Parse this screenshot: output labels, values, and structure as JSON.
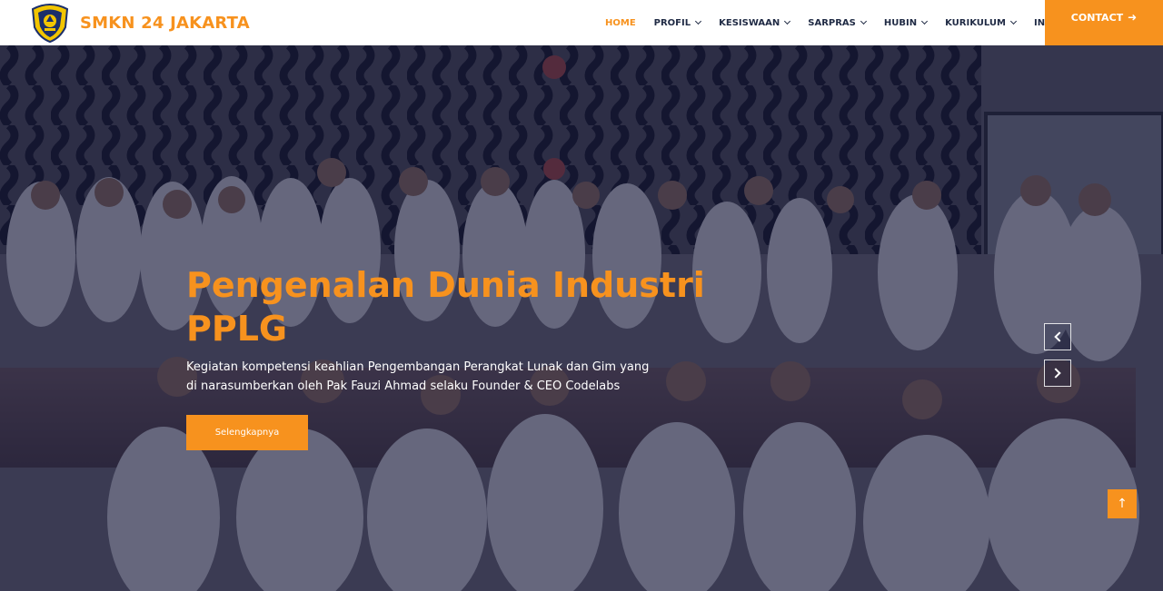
{
  "header": {
    "brand_name": "SMKN 24 JAKARTA",
    "logo_icon": "school-crest-icon",
    "nav": [
      {
        "label": "HOME",
        "active": true,
        "has_dropdown": false
      },
      {
        "label": "PROFIL",
        "active": false,
        "has_dropdown": true
      },
      {
        "label": "KESISWAAN",
        "active": false,
        "has_dropdown": true
      },
      {
        "label": "SARPRAS",
        "active": false,
        "has_dropdown": true
      },
      {
        "label": "HUBIN",
        "active": false,
        "has_dropdown": true
      },
      {
        "label": "KURIKULUM",
        "active": false,
        "has_dropdown": true
      },
      {
        "label": "INFO",
        "active": false,
        "has_dropdown": true
      }
    ],
    "contact_label": "CONTACT",
    "contact_icon": "arrow-right-icon"
  },
  "hero": {
    "title_line1": "Pengenalan Dunia Industri",
    "title_line2": "PPLG",
    "description": "Kegiatan kompetensi keahlian Pengembangan Perangkat Lunak dan Gim yang di narasumberkan oleh Pak Fauzi Ahmad selaku Founder & CEO Codelabs",
    "button_label": "Selengkapnya",
    "prev_icon": "chevron-left-icon",
    "next_icon": "chevron-right-icon"
  },
  "scroll_top_icon": "arrow-up-icon",
  "colors": {
    "accent": "#f7921e",
    "nav_text": "#1f2a44",
    "overlay": "#141634"
  }
}
